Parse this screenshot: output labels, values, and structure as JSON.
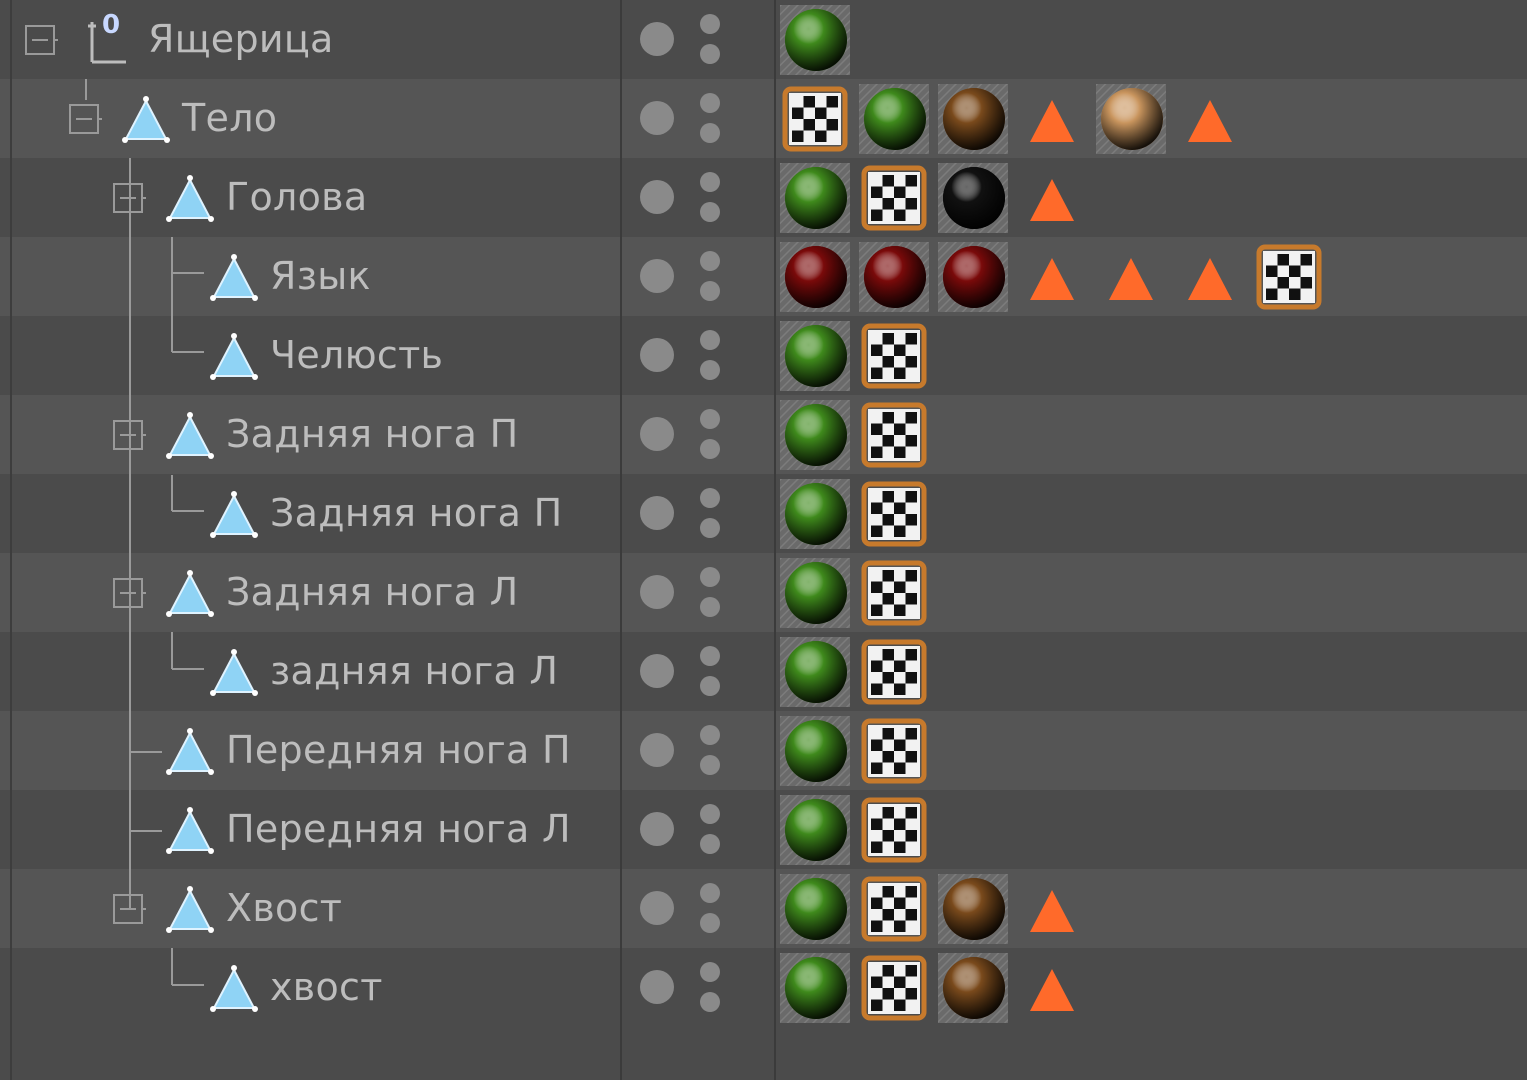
{
  "object_manager": {
    "rows": [
      {
        "label": "Ящерица",
        "icon": "null-object-icon",
        "expanded": true,
        "tags": [
          "material-green"
        ]
      },
      {
        "label": "Тело",
        "icon": "joint-icon",
        "expanded": true,
        "tags": [
          "texture-checker",
          "material-green",
          "material-brown",
          "selection-triangle",
          "material-tan",
          "selection-triangle"
        ]
      },
      {
        "label": "Голова",
        "icon": "joint-icon",
        "expanded": true,
        "tags": [
          "material-green",
          "texture-checker",
          "material-black",
          "selection-triangle"
        ]
      },
      {
        "label": "Язык",
        "icon": "joint-icon",
        "expanded": false,
        "tags": [
          "material-red",
          "material-red",
          "material-red",
          "selection-triangle",
          "selection-triangle",
          "selection-triangle",
          "texture-checker"
        ]
      },
      {
        "label": "Челюсть",
        "icon": "joint-icon",
        "expanded": false,
        "tags": [
          "material-green",
          "texture-checker"
        ]
      },
      {
        "label": "Задняя нога П",
        "icon": "joint-icon",
        "expanded": true,
        "tags": [
          "material-green",
          "texture-checker"
        ]
      },
      {
        "label": "Задняя нога П",
        "icon": "joint-icon",
        "expanded": false,
        "tags": [
          "material-green",
          "texture-checker"
        ]
      },
      {
        "label": "Задняя нога Л",
        "icon": "joint-icon",
        "expanded": true,
        "tags": [
          "material-green",
          "texture-checker"
        ]
      },
      {
        "label": "задняя нога Л",
        "icon": "joint-icon",
        "expanded": false,
        "tags": [
          "material-green",
          "texture-checker"
        ]
      },
      {
        "label": "Передняя нога П",
        "icon": "joint-icon",
        "expanded": false,
        "tags": [
          "material-green",
          "texture-checker"
        ]
      },
      {
        "label": "Передняя нога Л",
        "icon": "joint-icon",
        "expanded": false,
        "tags": [
          "material-green",
          "texture-checker"
        ]
      },
      {
        "label": "Хвост",
        "icon": "joint-icon",
        "expanded": true,
        "tags": [
          "material-green",
          "texture-checker",
          "material-brown",
          "selection-triangle"
        ]
      },
      {
        "label": "хвост",
        "icon": "joint-icon",
        "expanded": false,
        "tags": [
          "material-green",
          "texture-checker",
          "material-brown",
          "selection-triangle"
        ]
      }
    ],
    "null_badge": "0"
  },
  "colors": {
    "row_dark": "#4b4b4b",
    "row_light": "#555555",
    "label": "#bdbdbd",
    "joint_icon": "#8fd3f5",
    "selection_triangle": "#ff6a2a",
    "checker_border": "#c77a2c",
    "material_green": "#3f8a1c",
    "material_brown": "#7a4a1c",
    "material_tan": "#c9955e",
    "material_black": "#111111",
    "material_red": "#7a0a0a"
  }
}
